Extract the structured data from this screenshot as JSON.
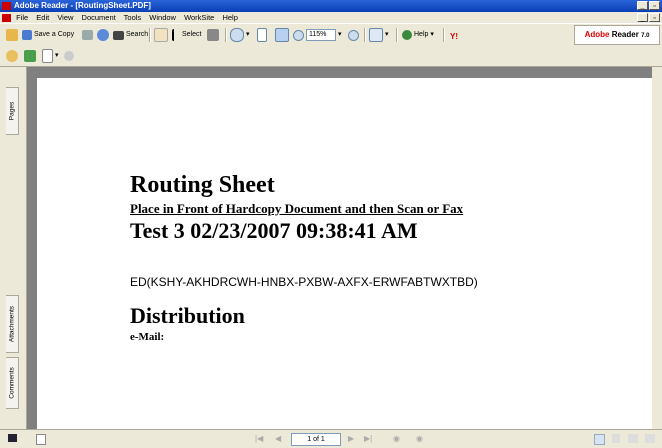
{
  "window": {
    "title": "Adobe Reader - [RoutingSheet.PDF]"
  },
  "menu": [
    "File",
    "Edit",
    "View",
    "Document",
    "Tools",
    "Window",
    "WorkSite",
    "Help"
  ],
  "toolbar": {
    "save_copy": "Save a Copy",
    "search": "Search",
    "select": "Select",
    "zoom_value": "115%",
    "help": "Help",
    "brand": "Adobe",
    "brand2": "Reader",
    "brand_version": "7.0"
  },
  "sidebar": {
    "tabs": [
      "Pages",
      "Attachments",
      "Comments"
    ]
  },
  "document": {
    "title": "Routing Sheet",
    "subtitle": "Place in Front of Hardcopy Document and then Scan or Fax",
    "test_line": "Test 3 02/23/2007 09:38:41 AM",
    "ed_code": "ED(KSHY-AKHDRCWH-HNBX-PXBW-AXFX-ERWFABTWXTBD)",
    "distribution": "Distribution",
    "email_label": "e-Mail:"
  },
  "status": {
    "page_indicator": "1 of 1"
  }
}
